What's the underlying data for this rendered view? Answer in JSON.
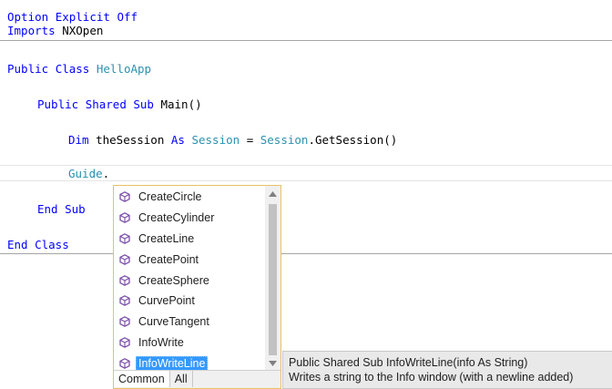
{
  "code": {
    "line1": {
      "kw1": "Option",
      "kw2": "Explicit",
      "kw3": "Off"
    },
    "line2": {
      "kw": "Imports",
      "text": " NXOpen"
    },
    "line3": {
      "kw1": "Public",
      "kw2": "Class",
      "type": "HelloApp"
    },
    "line4": {
      "kw1": "Public",
      "kw2": "Shared",
      "kw3": "Sub",
      "text": " Main()"
    },
    "line5": {
      "kw1": "Dim",
      "text1": " theSession ",
      "kw2": "As",
      "type1": "Session",
      "text2": " = ",
      "type2": "Session",
      "text3": ".GetSession()"
    },
    "line6": {
      "type": "Guide",
      "text": "."
    },
    "line7": {
      "kw1": "End",
      "kw2": "Sub"
    },
    "line8": {
      "kw1": "End",
      "kw2": "Class"
    }
  },
  "intellisense": {
    "items": [
      {
        "label": "CreateCircle",
        "icon": "method-icon"
      },
      {
        "label": "CreateCylinder",
        "icon": "method-icon"
      },
      {
        "label": "CreateLine",
        "icon": "method-icon"
      },
      {
        "label": "CreatePoint",
        "icon": "method-icon"
      },
      {
        "label": "CreateSphere",
        "icon": "method-icon"
      },
      {
        "label": "CurvePoint",
        "icon": "method-icon"
      },
      {
        "label": "CurveTangent",
        "icon": "method-icon"
      },
      {
        "label": "InfoWrite",
        "icon": "method-icon"
      },
      {
        "label": "InfoWriteLine",
        "icon": "method-icon"
      }
    ],
    "selected": "InfoWriteLine",
    "tabs": [
      "Common",
      "All"
    ],
    "active_tab": "Common"
  },
  "tooltip": {
    "signature": "Public Shared Sub InfoWriteLine(info As String)",
    "description": "Writes a string to the Info window (with a newline added)"
  },
  "colors": {
    "keyword": "#0000ff",
    "type": "#2b91af",
    "selection": "#3399ff",
    "popup_border": "#e5c365",
    "method_icon": "#7b4fa8"
  }
}
